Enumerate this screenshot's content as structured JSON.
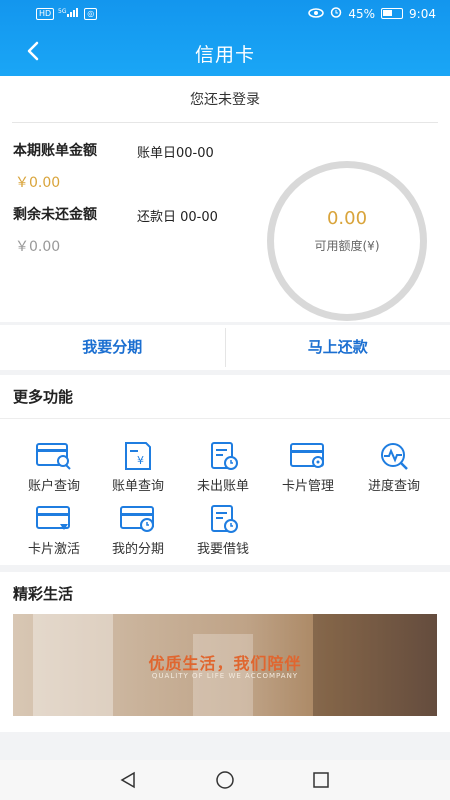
{
  "status_bar": {
    "left_icons": [
      "hd-icon",
      "signal-4g-icon",
      "app-icon"
    ],
    "right_battery": "45%",
    "time": "9:04"
  },
  "header": {
    "title": "信用卡",
    "back_icon": "chevron-left-icon"
  },
  "login_tip": "您还未登录",
  "bill": {
    "current_label": "本期账单金额",
    "bill_day": "账单日00-00",
    "current_amount": "￥0.00",
    "remaining_label": "剩余未还金额",
    "repay_day": "还款日 00-00",
    "remaining_amount": "￥0.00",
    "available_amount": "0.00",
    "available_label": "可用额度(¥)",
    "accent_color": "#d9a43b"
  },
  "actions": [
    "我要分期",
    "马上还款"
  ],
  "more_functions": {
    "title": "更多功能",
    "items": [
      {
        "label": "账户查询",
        "icon": "account-query-icon"
      },
      {
        "label": "账单查询",
        "icon": "bill-query-icon"
      },
      {
        "label": "未出账单",
        "icon": "unbilled-icon"
      },
      {
        "label": "卡片管理",
        "icon": "card-manage-icon"
      },
      {
        "label": "进度查询",
        "icon": "progress-query-icon"
      },
      {
        "label": "卡片激活",
        "icon": "card-activate-icon"
      },
      {
        "label": "我的分期",
        "icon": "my-installment-icon"
      },
      {
        "label": "我要借钱",
        "icon": "borrow-icon"
      }
    ]
  },
  "life": {
    "title": "精彩生活",
    "banner_text": "优质生活，我们陪伴",
    "banner_sub": "QUALITY OF LIFE WE ACCOMPANY"
  },
  "colors": {
    "header": "#1396ee",
    "link_blue": "#1b6fd1",
    "icon_blue": "#1f7de0"
  }
}
